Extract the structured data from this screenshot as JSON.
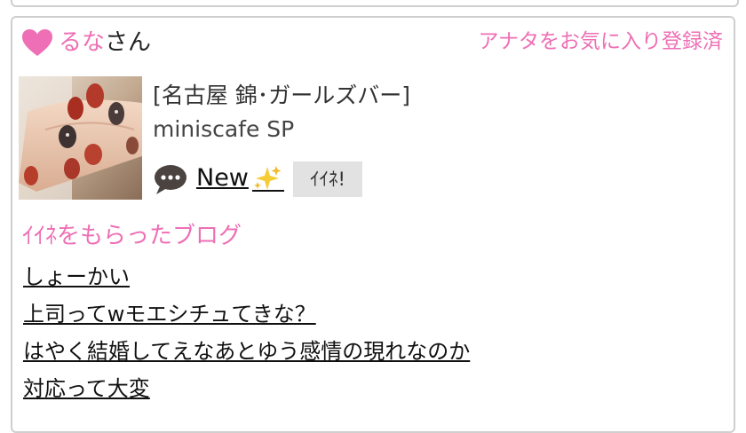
{
  "profile": {
    "name": "るな",
    "honorific": "さん",
    "favorite_status": "アナタをお気に入り登録済",
    "colors": {
      "accent": "#ee6fb5",
      "border": "#cfcfcf",
      "button_bg": "#e2e2e2"
    }
  },
  "shop": {
    "category": "[名古屋 錦･ガールズバー]",
    "name": "miniscafe SP"
  },
  "actions": {
    "new_label": "New",
    "iine_label": "ｲｲﾈ!"
  },
  "blogs": {
    "title": "ｲｲﾈをもらったブログ",
    "items": [
      {
        "title": "しょーかい"
      },
      {
        "title": "上司ってwモエシチュてきな？"
      },
      {
        "title": "はやく結婚してえなあとゆう感情の現れなのか"
      },
      {
        "title": "対応って大変"
      }
    ]
  },
  "icons": [
    "heart-icon",
    "chat-bubble-icon",
    "sparkle-icon"
  ]
}
